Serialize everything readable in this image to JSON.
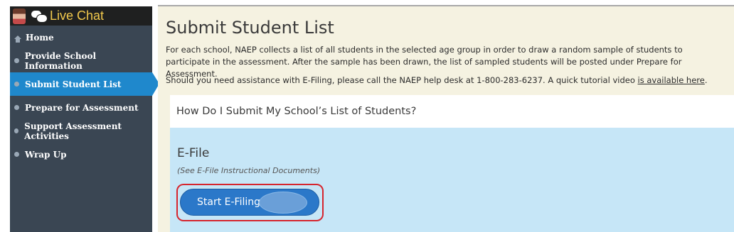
{
  "sidebar": {
    "live_chat": "Live Chat",
    "items": [
      {
        "label": "Home"
      },
      {
        "label": "Provide School Information"
      },
      {
        "label": "Submit Student List"
      },
      {
        "label": "Prepare for Assessment"
      },
      {
        "label": "Support Assessment Activities"
      },
      {
        "label": "Wrap Up"
      }
    ]
  },
  "main": {
    "title": "Submit Student List",
    "intro": "For each school, NAEP collects a list of all students in the selected age group in order to draw a random sample of students to participate in the assessment. After the sample has been drawn, the list of sampled students will be posted under Prepare for Assessment.",
    "help_text": "Should you need assistance with E-Filing, please call the NAEP help desk at 1-800-283-6237. A quick tutorial video ",
    "help_link": "is available here",
    "help_end": ".",
    "faq_question": "How Do I Submit My School’s List of Students?",
    "efile": {
      "heading": "E-File",
      "note": "(See E-File Instructional Documents)",
      "button": "Start E-Filing"
    }
  },
  "colors": {
    "sidebar_bg": "#3a4653",
    "active_nav": "#1f88cc",
    "live_chat_text": "#f2c94c",
    "main_bg": "#f5f2e1",
    "efile_panel": "#c6e6f7",
    "button": "#2b78c9",
    "highlight": "#d6252e"
  }
}
